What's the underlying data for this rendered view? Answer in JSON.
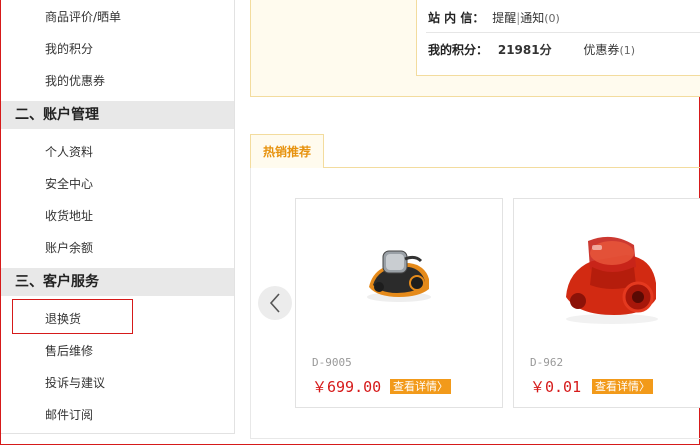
{
  "sidebar": {
    "items_top": [
      "商品评价/晒单",
      "我的积分",
      "我的优惠券"
    ],
    "section2": "二、账户管理",
    "items_account": [
      "个人资料",
      "安全中心",
      "收货地址",
      "账户余额"
    ],
    "section3": "三、客户服务",
    "items_service": [
      "退换货",
      "售后维修",
      "投诉与建议",
      "邮件订阅"
    ]
  },
  "info": {
    "inbox_label": "站 内 信：",
    "inbox_reminder": "提醒",
    "inbox_notice": "通知",
    "inbox_count": "(0)",
    "points_label": "我的积分：",
    "points_value": "21981分",
    "coupon_label": "优惠券",
    "coupon_count": "(1)"
  },
  "hot": {
    "tab_label": "热销推荐",
    "products": [
      {
        "model": "D-9005",
        "price": "￥699.00",
        "detail": "查看详情"
      },
      {
        "model": "D-962",
        "price": "￥0.01",
        "detail": "查看详情"
      }
    ]
  },
  "colors": {
    "accent": "#d61a1a",
    "orange": "#f29a1a",
    "tab_text": "#e7930f"
  }
}
